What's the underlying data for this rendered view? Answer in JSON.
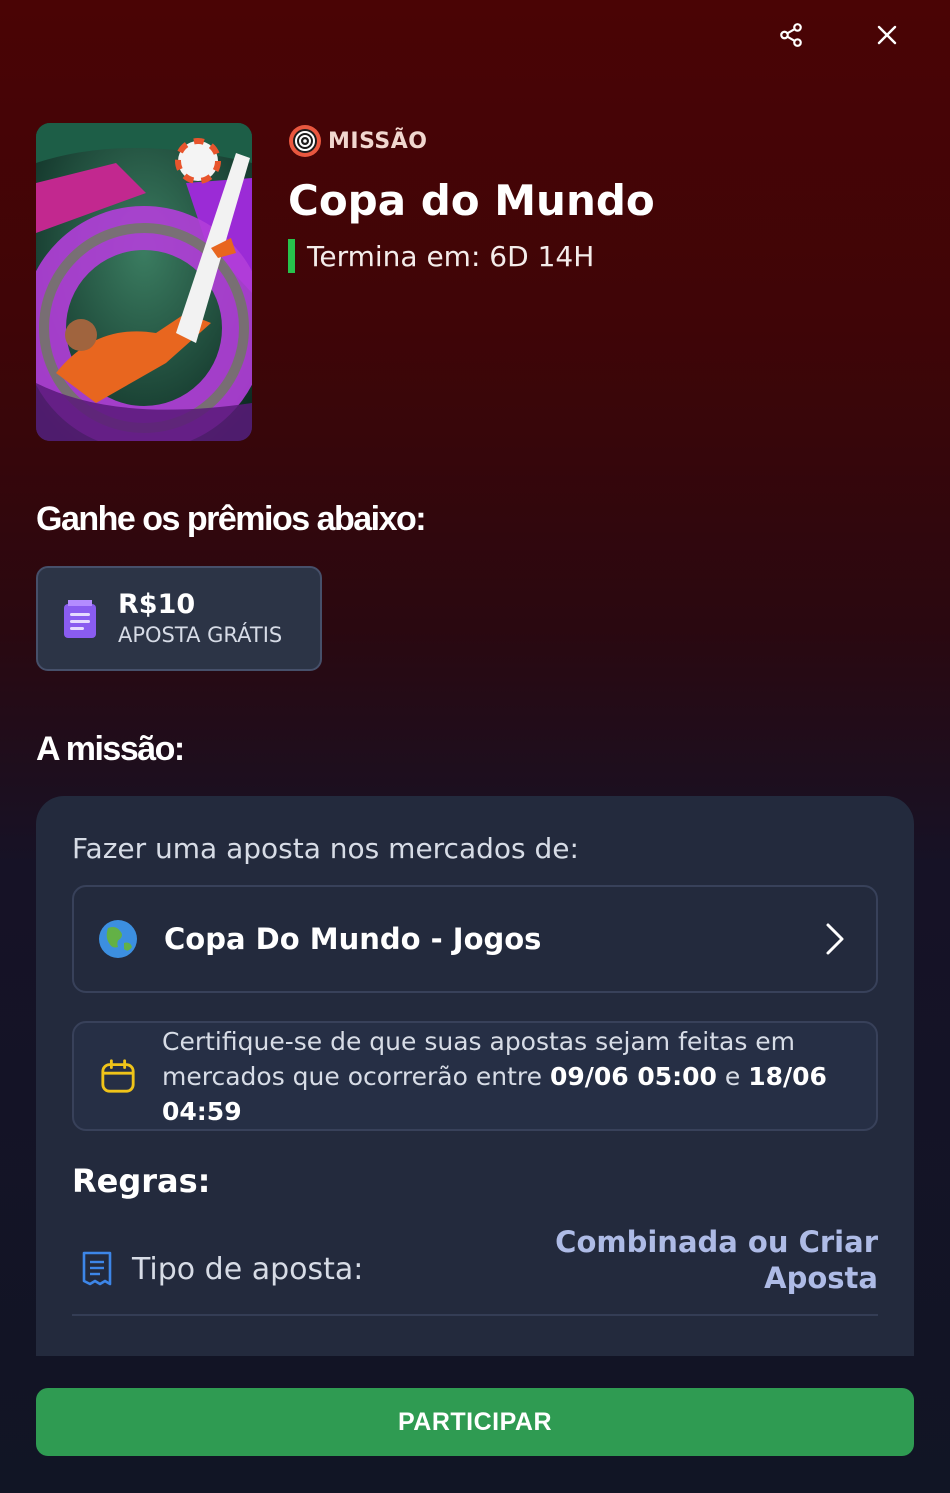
{
  "header": {
    "share_icon": "share-icon",
    "close_icon": "close-icon"
  },
  "hero": {
    "badge_icon": "target-icon",
    "badge_label": "MISSÃO",
    "title": "Copa do Mundo",
    "ends_label": "Termina em: 6D 14H",
    "ends_color": "#27c24c"
  },
  "prizes": {
    "title": "Ganhe os prêmios abaixo:",
    "items": [
      {
        "icon": "freebet-ticket-icon",
        "amount": "R$10",
        "type": "APOSTA GRÁTIS"
      }
    ]
  },
  "mission": {
    "title": "A missão:",
    "intro": "Fazer uma aposta nos mercados de:",
    "market": {
      "icon": "globe-icon",
      "label": "Copa Do Mundo - Jogos"
    },
    "notice": {
      "icon": "calendar-icon",
      "line1": "Certifique-se de que suas apostas sejam feitas em",
      "line2_prefix": "mercados que ocorrerão entre",
      "start": "09/06 05:00",
      "connector": "e",
      "end": "18/06 04:59"
    },
    "rules_title": "Regras:",
    "rules": [
      {
        "icon": "receipt-icon",
        "label": "Tipo de aposta:",
        "value_line1": "Combinada ou Criar",
        "value_line2": "Aposta"
      }
    ]
  },
  "cta": {
    "label": "PARTICIPAR",
    "color": "#2f9b52"
  }
}
